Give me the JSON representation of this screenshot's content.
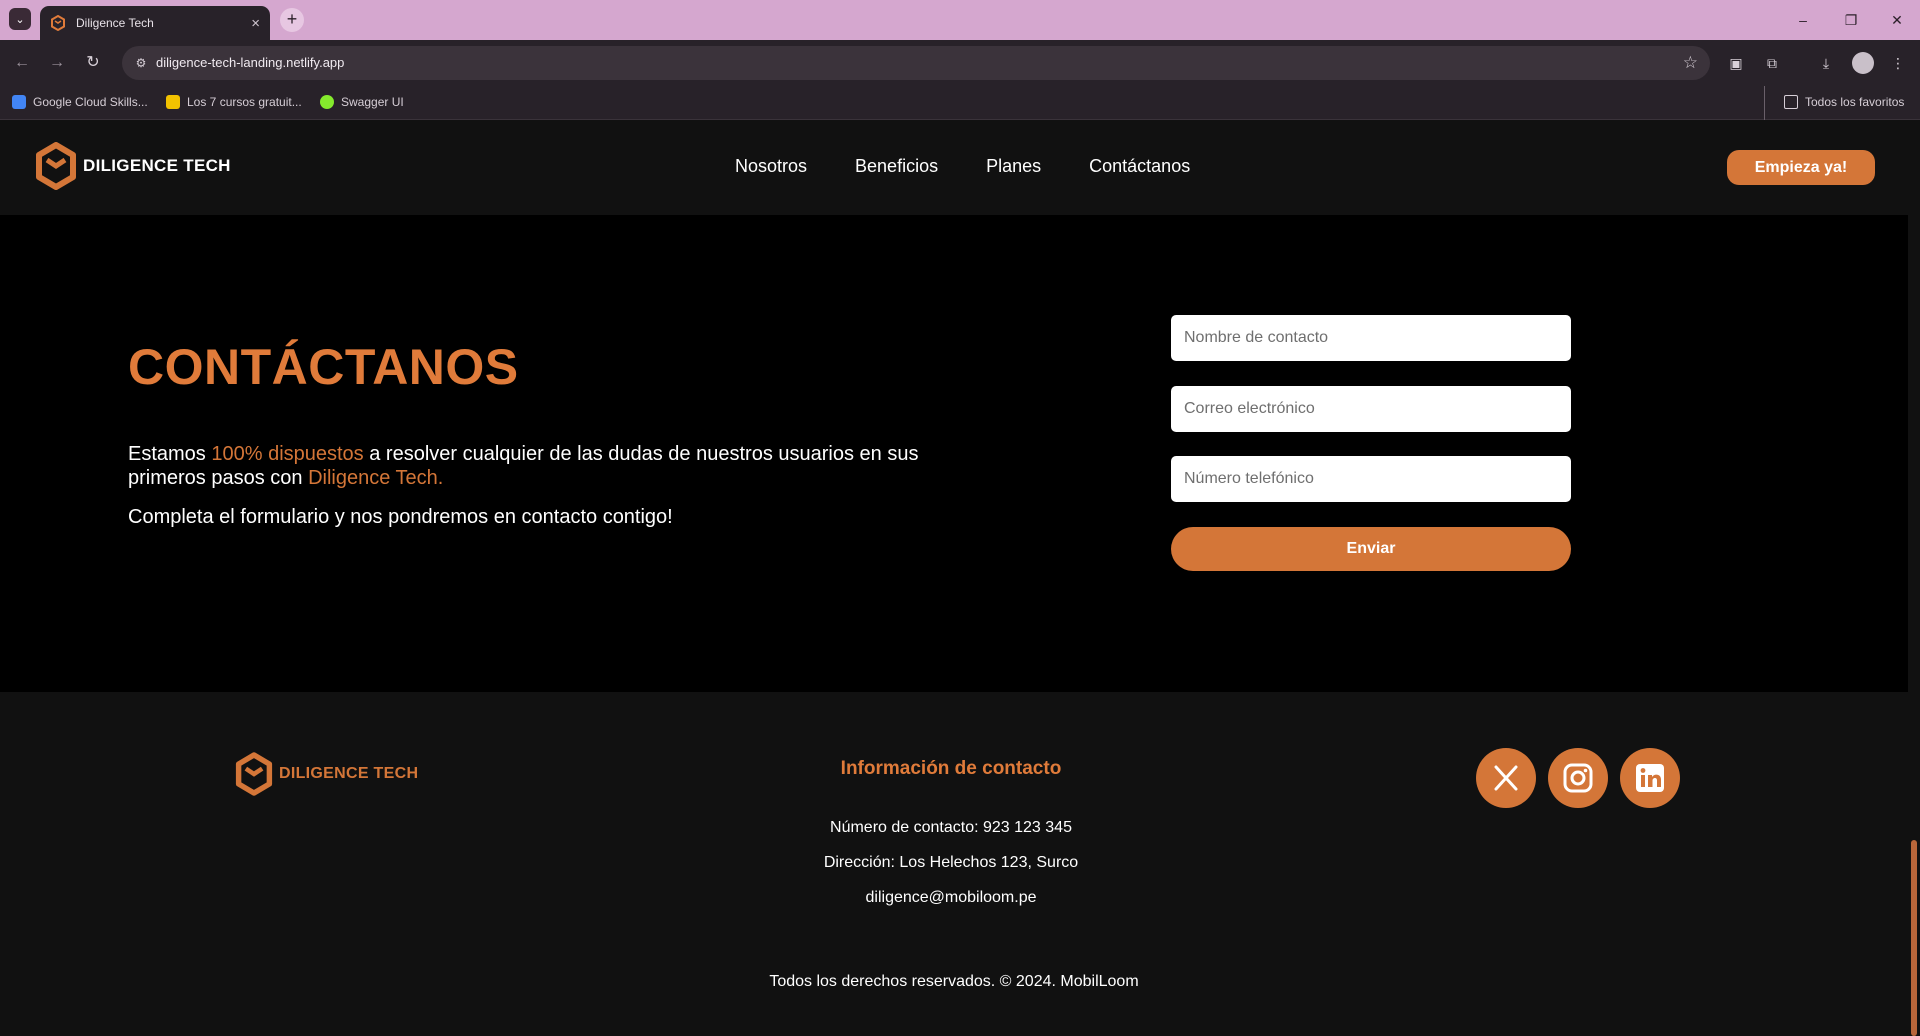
{
  "browser": {
    "tab_title": "Diligence Tech",
    "url": "diligence-tech-landing.netlify.app",
    "bookmarks": [
      {
        "label": "Google Cloud Skills...",
        "color": "#4285f4"
      },
      {
        "label": "Los 7 cursos gratuit...",
        "color": "#f2c200"
      },
      {
        "label": "Swagger UI",
        "color": "#85ea2d"
      }
    ],
    "all_bookmarks_label": "Todos los favoritos"
  },
  "header": {
    "brand": "DILIGENCE TECH",
    "nav": [
      "Nosotros",
      "Beneficios",
      "Planes",
      "Contáctanos"
    ],
    "cta": "Empieza ya!"
  },
  "contact": {
    "title": "CONTÁCTANOS",
    "text_part1": "Estamos ",
    "text_accent1": "100% dispuestos",
    "text_part2": " a resolver cualquier de las dudas de nuestros usuarios en sus primeros pasos con ",
    "text_accent2": "Diligence Tech.",
    "text2": "Completa el formulario y nos pondremos en contacto contigo!",
    "form": {
      "name_placeholder": "Nombre de contacto",
      "email_placeholder": "Correo electrónico",
      "phone_placeholder": "Número telefónico",
      "submit": "Enviar"
    }
  },
  "footer": {
    "brand": "DILIGENCE TECH",
    "info_title": "Información de contacto",
    "phone": "Número de contacto: 923 123 345",
    "address": "Dirección: Los Helechos 123, Surco",
    "email": "diligence@mobiloom.pe",
    "social": [
      "x-icon",
      "instagram-icon",
      "linkedin-icon"
    ],
    "copyright": "Todos los derechos reservados. © 2024. MobilLoom"
  },
  "colors": {
    "accent": "#d47638",
    "page_bg": "#000000",
    "header_bg": "#111111",
    "browser_tabbar": "#d5a7cf"
  }
}
